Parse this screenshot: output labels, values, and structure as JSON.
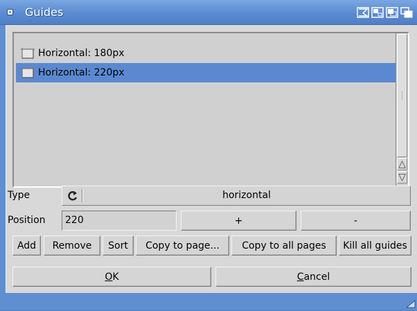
{
  "window": {
    "title": "Guides"
  },
  "guides": {
    "items": [
      {
        "label": "Horizontal: 180px",
        "selected": false
      },
      {
        "label": "Horizontal: 220px",
        "selected": true
      }
    ]
  },
  "type_row": {
    "label": "Type",
    "value": "horizontal"
  },
  "position_row": {
    "label": "Position",
    "value": "220",
    "plus_label": "+",
    "minus_label": "-"
  },
  "actions": {
    "add": "Add",
    "remove": "Remove",
    "sort": "Sort",
    "copy_to_page": "Copy to page...",
    "copy_to_all": "Copy to all pages",
    "kill_all": "Kill all guides"
  },
  "footer": {
    "ok_prefix": "",
    "ok_underline": "O",
    "ok_rest": "K",
    "cancel_underline": "C",
    "cancel_rest": "ancel"
  },
  "colors": {
    "titlebar": "#5a8bd0",
    "selection": "#5b89d1",
    "panel": "#d8d8d8"
  },
  "icons": [
    "close-gadget-icon",
    "iconify-icon",
    "zoom-icon",
    "depth-icon",
    "depth-back-icon",
    "guide-icon",
    "cycle-icon",
    "scroll-up-icon",
    "scroll-down-icon",
    "resize-icon"
  ]
}
